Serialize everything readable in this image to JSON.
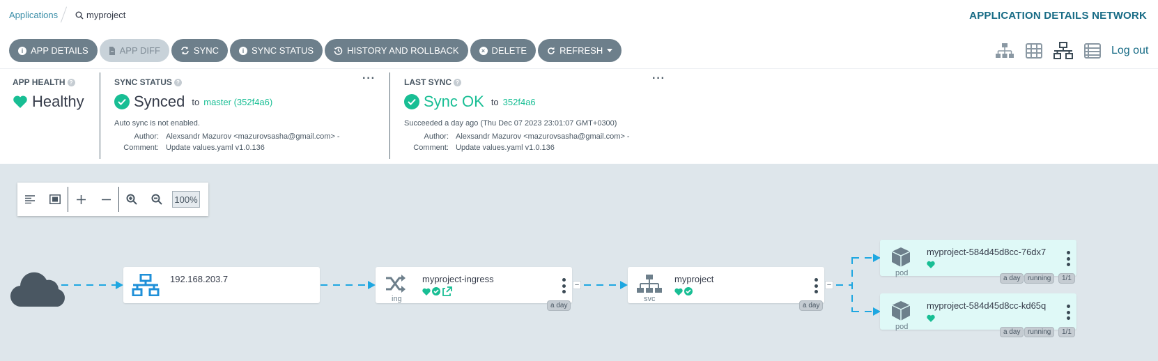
{
  "breadcrumb": {
    "applications": "Applications",
    "current": "myproject"
  },
  "page_title": "APPLICATION DETAILS NETWORK",
  "toolbar": {
    "app_details": "APP DETAILS",
    "app_diff": "APP DIFF",
    "sync": "SYNC",
    "sync_status": "SYNC STATUS",
    "history": "HISTORY AND ROLLBACK",
    "delete": "DELETE",
    "refresh": "REFRESH"
  },
  "logout": "Log out",
  "app_health": {
    "label": "APP HEALTH",
    "value": "Healthy"
  },
  "sync_status": {
    "label": "SYNC STATUS",
    "value": "Synced",
    "to": "to",
    "revision": "master (352f4a6)",
    "auto_sync": "Auto sync is not enabled.",
    "author_label": "Author:",
    "author": "Alexsandr Mazurov <mazurovsasha@gmail.com> -",
    "comment_label": "Comment:",
    "comment": "Update values.yaml v1.0.136"
  },
  "last_sync": {
    "label": "LAST SYNC",
    "value": "Sync OK",
    "to": "to",
    "revision": "352f4a6",
    "succeeded": "Succeeded a day ago (Thu Dec 07 2023 23:01:07 GMT+0300)",
    "author_label": "Author:",
    "author": "Alexsandr Mazurov <mazurovsasha@gmail.com> -",
    "comment_label": "Comment:",
    "comment": "Update values.yaml v1.0.136"
  },
  "zoom": {
    "value": "100%"
  },
  "nodes": {
    "ip": {
      "name": "192.168.203.7"
    },
    "ingress": {
      "name": "myproject-ingress",
      "kind": "ing",
      "age": "a day"
    },
    "svc": {
      "name": "myproject",
      "kind": "svc",
      "age": "a day"
    },
    "pod1": {
      "name": "myproject-584d45d8cc-76dx7",
      "kind": "pod",
      "age": "a day",
      "status": "running",
      "ready": "1/1"
    },
    "pod2": {
      "name": "myproject-584d45d8cc-kd65q",
      "kind": "pod",
      "age": "a day",
      "status": "running",
      "ready": "1/1"
    }
  },
  "colors": {
    "accent": "#176b85",
    "green": "#18be94",
    "button": "#6d7f8b",
    "edge": "#1ea7e1",
    "graph_bg": "#dee6eb"
  }
}
